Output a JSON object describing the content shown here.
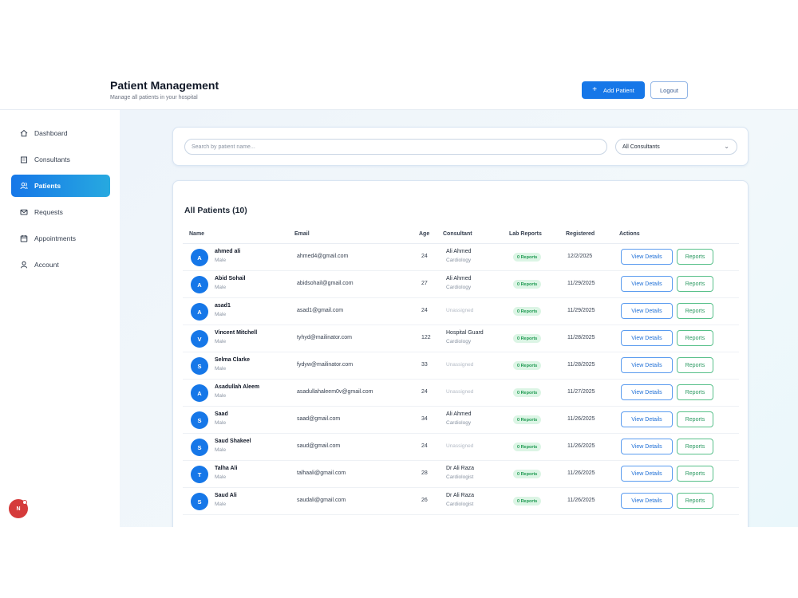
{
  "header": {
    "title": "Patient Management",
    "subtitle": "Manage all patients in your hospital",
    "add_button": "Add Patient",
    "logout_button": "Logout"
  },
  "sidebar": {
    "items": [
      {
        "label": "Dashboard",
        "icon": "home-icon"
      },
      {
        "label": "Consultants",
        "icon": "building-icon"
      },
      {
        "label": "Patients",
        "icon": "users-icon",
        "active": true
      },
      {
        "label": "Requests",
        "icon": "mail-icon"
      },
      {
        "label": "Appointments",
        "icon": "calendar-icon"
      },
      {
        "label": "Account",
        "icon": "user-icon"
      }
    ],
    "user_badge": "N"
  },
  "filters": {
    "search_placeholder": "Search by patient name...",
    "consultant_select": "All Consultants"
  },
  "table": {
    "title": "All Patients (10)",
    "columns": [
      "Name",
      "Email",
      "Age",
      "Consultant",
      "Lab Reports",
      "Registered",
      "Actions"
    ],
    "view_label": "View Details",
    "reports_label": "Reports",
    "rows": [
      {
        "initial": "A",
        "name": "ahmed ali",
        "gender": "Male",
        "email": "ahmed4@gmail.com",
        "age": "24",
        "consultant": "Ali Ahmed",
        "specialty": "Cardiology",
        "lab": "0 Reports",
        "registered": "12/2/2025"
      },
      {
        "initial": "A",
        "name": "Abid Sohail",
        "gender": "Male",
        "email": "abidsohail@gmail.com",
        "age": "27",
        "consultant": "Ali Ahmed",
        "specialty": "Cardiology",
        "lab": "0 Reports",
        "registered": "11/29/2025"
      },
      {
        "initial": "A",
        "name": "asad1",
        "gender": "Male",
        "email": "asad1@gmail.com",
        "age": "24",
        "consultant": "",
        "specialty": "",
        "unassigned": "Unassigned",
        "lab": "0 Reports",
        "registered": "11/29/2025"
      },
      {
        "initial": "V",
        "name": "Vincent Mitchell",
        "gender": "Male",
        "email": "tyhyd@mailinator.com",
        "age": "122",
        "consultant": "Hospital Guard",
        "specialty": "Cardiology",
        "lab": "0 Reports",
        "registered": "11/28/2025"
      },
      {
        "initial": "S",
        "name": "Selma Clarke",
        "gender": "Male",
        "email": "fydyw@mailinator.com",
        "age": "33",
        "consultant": "",
        "specialty": "",
        "unassigned": "Unassigned",
        "lab": "0 Reports",
        "registered": "11/28/2025"
      },
      {
        "initial": "A",
        "name": "Asadullah Aleem",
        "gender": "Male",
        "email": "asadullahaleem0v@gmail.com",
        "age": "24",
        "consultant": "",
        "specialty": "",
        "unassigned": "Unassigned",
        "lab": "0 Reports",
        "registered": "11/27/2025"
      },
      {
        "initial": "S",
        "name": "Saad",
        "gender": "Male",
        "email": "saad@gmail.com",
        "age": "34",
        "consultant": "Ali Ahmed",
        "specialty": "Cardiology",
        "lab": "0 Reports",
        "registered": "11/26/2025"
      },
      {
        "initial": "S",
        "name": "Saud Shakeel",
        "gender": "Male",
        "email": "saud@gmail.com",
        "age": "24",
        "consultant": "",
        "specialty": "",
        "unassigned": "Unassigned",
        "lab": "0 Reports",
        "registered": "11/26/2025"
      },
      {
        "initial": "T",
        "name": "Talha Ali",
        "gender": "Male",
        "email": "talhaali@gmail.com",
        "age": "28",
        "consultant": "Dr Ali Raza",
        "specialty": "Cardiologist",
        "lab": "0 Reports",
        "registered": "11/26/2025"
      },
      {
        "initial": "S",
        "name": "Saud Ali",
        "gender": "Male",
        "email": "saudali@gmail.com",
        "age": "26",
        "consultant": "Dr Ali Raza",
        "specialty": "Cardiologist",
        "lab": "0 Reports",
        "registered": "11/26/2025"
      }
    ]
  },
  "colors": {
    "primary": "#1677e8",
    "success": "#1e9a51",
    "danger": "#d53b3b"
  }
}
